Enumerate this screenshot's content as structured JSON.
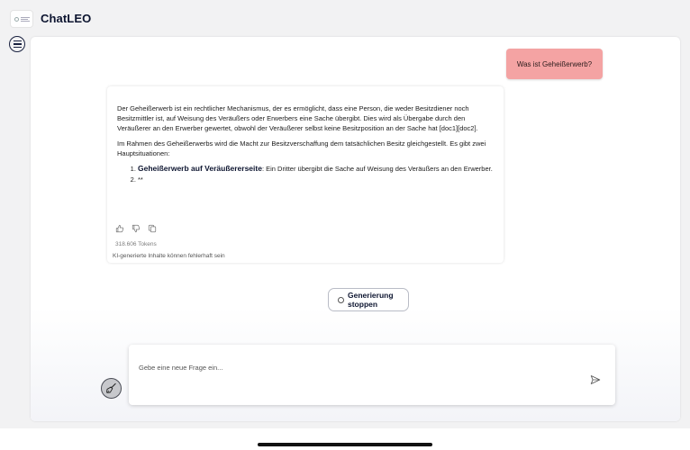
{
  "app": {
    "title": "ChatLEO"
  },
  "conversation": {
    "user_message": "Was ist Geheißerwerb?",
    "answer": {
      "paragraph1": "Der Geheißerwerb ist ein rechtlicher Mechanismus, der es ermöglicht, dass eine Person, die weder Besitzdiener noch Besitzmittler ist, auf Weisung des Veräußers oder Erwerbers eine Sache übergibt. Dies wird als Übergabe durch den Veräußerer an den Erwerber gewertet, obwohl der Veräußerer selbst keine Besitzposition an der Sache hat [doc1][doc2].",
      "paragraph2": "Im Rahmen des Geheißerwerbs wird die Macht zur Besitzverschaffung dem tatsächlichen Besitz gleichgestellt. Es gibt zwei Hauptsituationen:",
      "list": [
        {
          "bold": "Geheißerwerb auf Veräußererseite",
          "text": ": Ein Dritter übergibt die Sache auf Weisung des Veräußers an den Erwerber."
        },
        {
          "bold": "",
          "text": "**"
        }
      ],
      "actions": [
        {
          "name": "thumbs-up-icon"
        },
        {
          "name": "thumbs-down-icon"
        },
        {
          "name": "copy-icon"
        }
      ],
      "tokens": "318.606 Tokens",
      "disclaimer": "KI-generierte Inhalte können fehlerhaft sein"
    }
  },
  "stop_button": {
    "label": "Generierung stoppen"
  },
  "input": {
    "placeholder": "Gebe eine neue Frage ein...",
    "value": ""
  },
  "icons": {
    "menu": "hamburger-menu-icon",
    "clear": "broom-icon",
    "send": "send-icon",
    "stop": "stop-circle-icon"
  },
  "colors": {
    "user_bubble": "#f4a3a3",
    "title_navy": "#0d1530"
  }
}
